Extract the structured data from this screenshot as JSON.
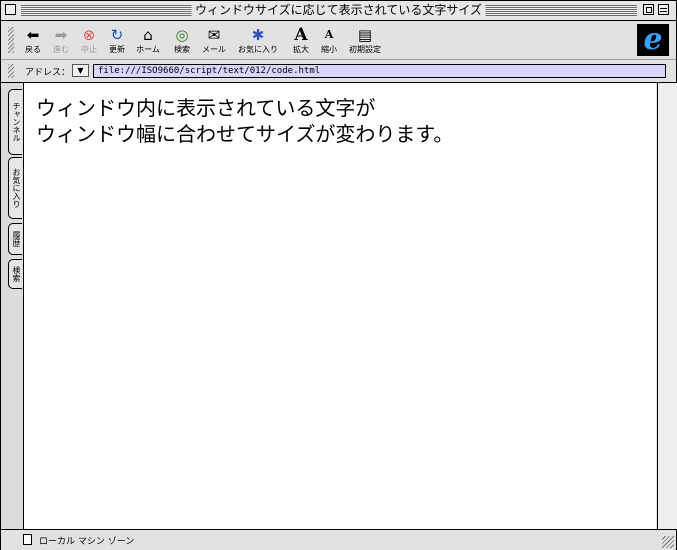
{
  "window": {
    "title": "ウィンドウサイズに応じて表示されている文字サイズ"
  },
  "toolbar": {
    "buttons": [
      {
        "label": "戻る",
        "icon": "back-arrow-icon",
        "enabled": true
      },
      {
        "label": "進む",
        "icon": "forward-arrow-icon",
        "enabled": false
      },
      {
        "label": "中止",
        "icon": "stop-icon",
        "enabled": false
      },
      {
        "label": "更新",
        "icon": "refresh-icon",
        "enabled": true
      },
      {
        "label": "ホーム",
        "icon": "home-icon",
        "enabled": true
      },
      {
        "label": "検索",
        "icon": "search-globe-icon",
        "enabled": true
      },
      {
        "label": "メール",
        "icon": "mail-icon",
        "enabled": true
      },
      {
        "label": "お気に入り",
        "icon": "favorites-icon",
        "enabled": true
      },
      {
        "label": "拡大",
        "icon": "text-larger-icon",
        "enabled": true
      },
      {
        "label": "縮小",
        "icon": "text-smaller-icon",
        "enabled": true
      },
      {
        "label": "初期設定",
        "icon": "preferences-icon",
        "enabled": true
      }
    ]
  },
  "addressbar": {
    "label": "アドレス：",
    "url": "file:///ISO9660/script/text/012/code.html"
  },
  "sidetabs": [
    "チャンネル",
    "お気に入り",
    "履歴",
    "検索"
  ],
  "content": {
    "line1": "ウィンドウ内に表示されている文字が",
    "line2": "ウィンドウ幅に合わせてサイズが変わります。"
  },
  "statusbar": {
    "zone": "ローカル マシン ゾーン"
  },
  "colors": {
    "address_background": "#d6d6ff",
    "ie_logo": "#3aa0ff"
  }
}
